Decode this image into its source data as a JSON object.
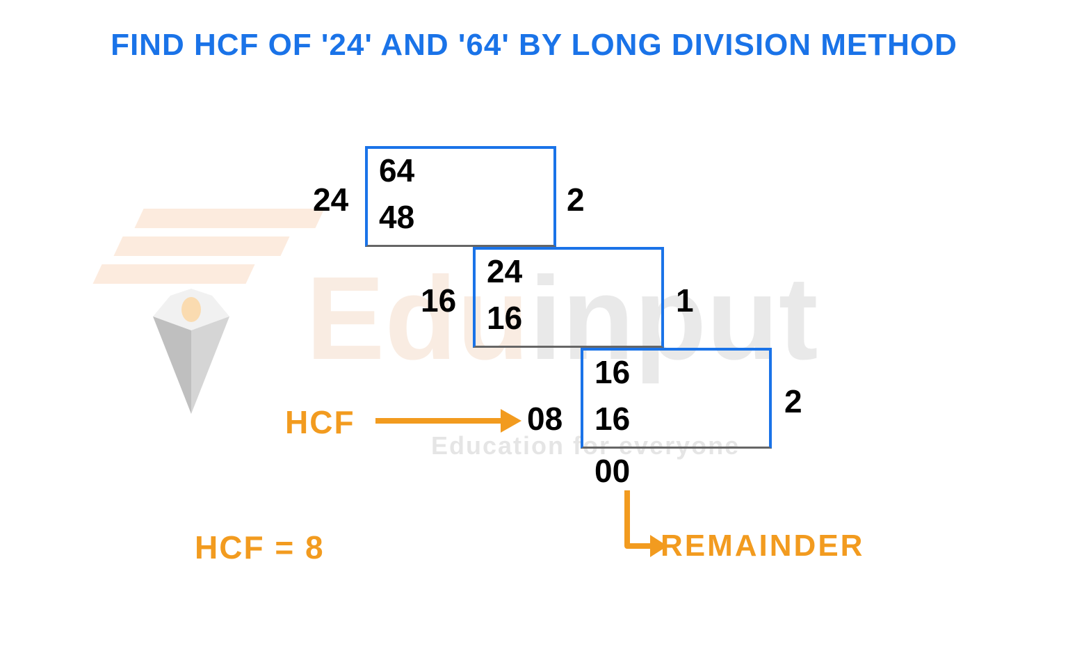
{
  "title": "FIND HCF OF '24' AND '64' BY LONG DIVISION METHOD",
  "steps": {
    "s1": {
      "divisor": "24",
      "dividend": "64",
      "product": "48",
      "quotient": "2"
    },
    "s2": {
      "divisor": "16",
      "dividend": "24",
      "product": "16",
      "quotient": "1"
    },
    "s3": {
      "divisor": "08",
      "dividend": "16",
      "product": "16",
      "quotient": "2",
      "remainder": "00"
    }
  },
  "labels": {
    "hcf_arrow": "HCF",
    "answer": "HCF = 8",
    "remainder": "REMAINDER"
  },
  "watermark": {
    "brand_a": "Edu",
    "brand_b": "input",
    "tagline": "Education for everyone"
  }
}
